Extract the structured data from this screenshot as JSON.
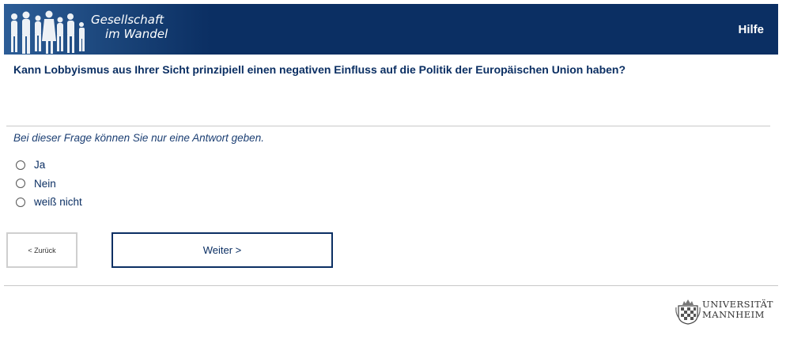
{
  "header": {
    "brand_line1": "Gesellschaft",
    "brand_line2": "im Wandel",
    "help_label": "Hilfe",
    "background_color": "#0b2f63"
  },
  "question": {
    "text": "Kann Lobbyismus aus Ihrer Sicht prinzipiell einen negativen Einfluss auf die Politik der Europäischen Union haben?"
  },
  "hint": "Bei dieser Frage können Sie nur eine Antwort geben.",
  "options": [
    {
      "label": "Ja",
      "selected": false
    },
    {
      "label": "Nein",
      "selected": false
    },
    {
      "label": "weiß nicht",
      "selected": false
    }
  ],
  "navigation": {
    "back_label": "< Zurück",
    "next_label": "Weiter >"
  },
  "footer": {
    "logo_line1": "UNIVERSITÄT",
    "logo_line2": "MANNHEIM"
  }
}
